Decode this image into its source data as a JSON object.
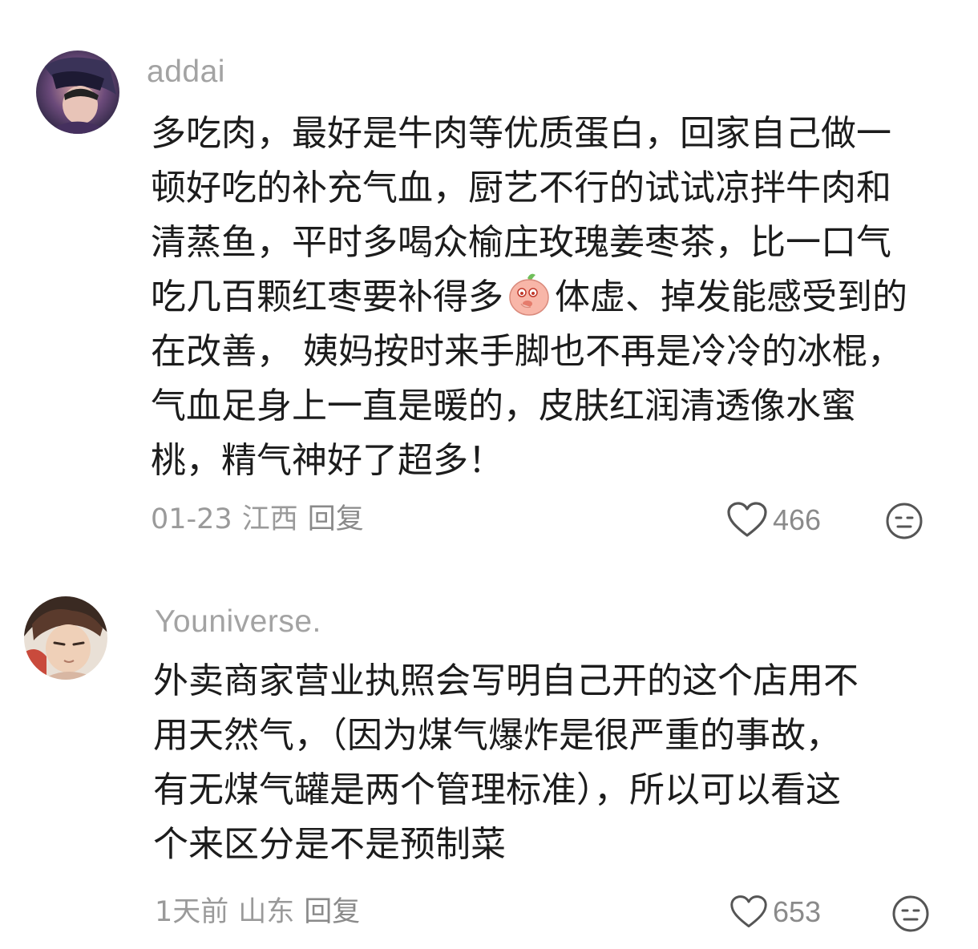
{
  "comments": [
    {
      "username": "addai",
      "text_before_emoji": "多吃肉，最好是牛肉等优质蛋白，回家自己做一顿好吃的补充气血，厨艺不行的试试凉拌牛肉和清蒸鱼，平时多喝众榆庄玫瑰姜枣茶，比一口气吃几百颗红枣要补得多",
      "emoji": "shy-peach-emoji",
      "text_after_emoji": "体虚、掉发能感受到的在改善， 姨妈按时来手脚也不再是冷冷的冰棍，气血足身上一直是暖的，皮肤红润清透像水蜜桃，精气神好了超多！",
      "date": "01-23",
      "location": "江西",
      "reply_label": "回复",
      "likes": "466",
      "like_icon": "heart-outline-icon",
      "reaction_icon": "neutral-face-icon"
    },
    {
      "username": "Youniverse.",
      "text": "外卖商家营业执照会写明自己开的这个店用不用天然气，（因为煤气爆炸是很严重的事故，有无煤气罐是两个管理标准），所以可以看这个来区分是不是预制菜",
      "date": "1天前",
      "location": "山东",
      "reply_label": "回复",
      "likes": "653",
      "like_icon": "heart-outline-icon",
      "reaction_icon": "neutral-face-icon"
    }
  ],
  "colors": {
    "username": "#a3a3a3",
    "text": "#1c1c1c",
    "meta": "#9a9a9a"
  }
}
